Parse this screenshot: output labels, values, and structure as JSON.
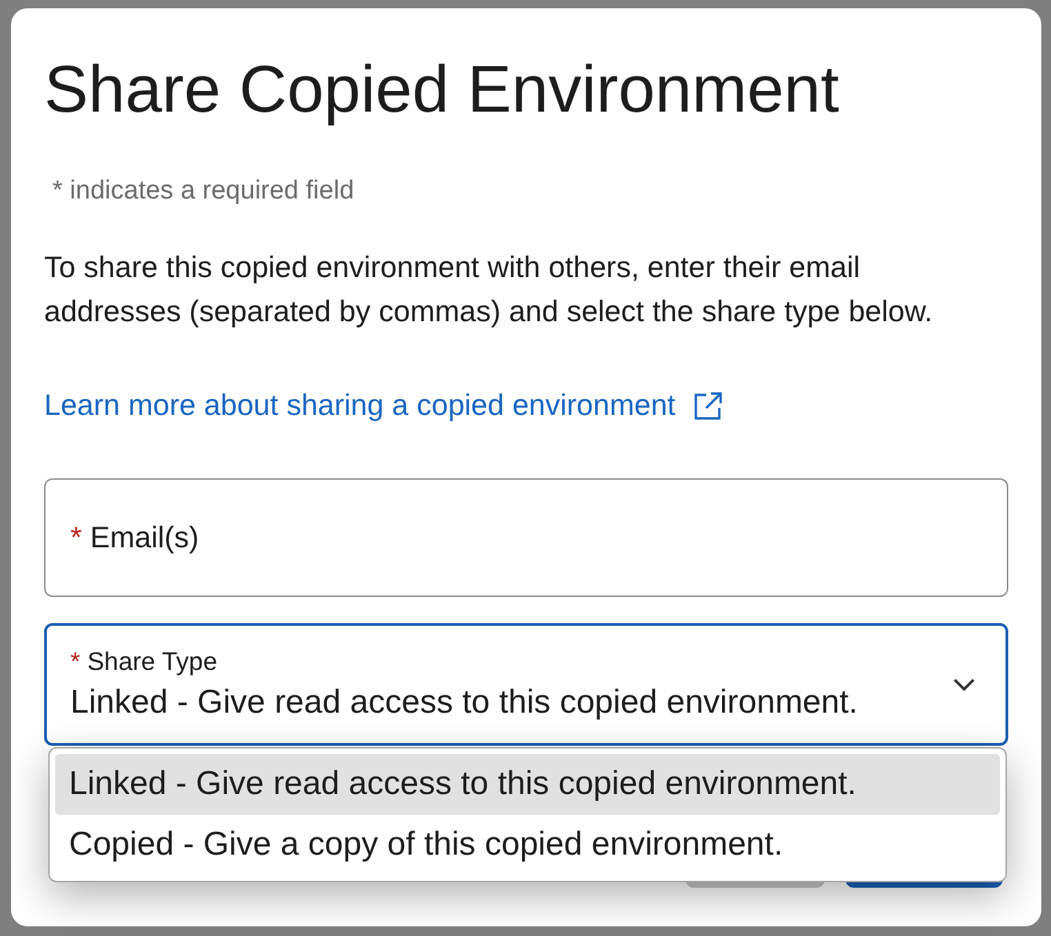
{
  "dialog": {
    "title": "Share Copied Environment",
    "required_note": "* indicates a required field",
    "description": "To share this copied environment with others, enter their email addresses (separated by commas) and select the share type below.",
    "help_link": {
      "label": "Learn more about sharing a copied environment",
      "external": true
    },
    "fields": [
      {
        "kind": "text",
        "required_marker": "*",
        "label": "Email(s)",
        "focused": false
      },
      {
        "kind": "select",
        "required_marker": "*",
        "label": "Share Type",
        "value": "Linked - Give read access to this copied environment.",
        "focused": true,
        "expanded": true,
        "options": [
          {
            "label": "Linked - Give read access to this copied environment.",
            "selected": true
          },
          {
            "label": "Copied - Give a copy of this copied environment.",
            "selected": false
          }
        ]
      }
    ],
    "buttons": [
      {
        "kind": "secondary"
      },
      {
        "kind": "primary"
      }
    ]
  }
}
